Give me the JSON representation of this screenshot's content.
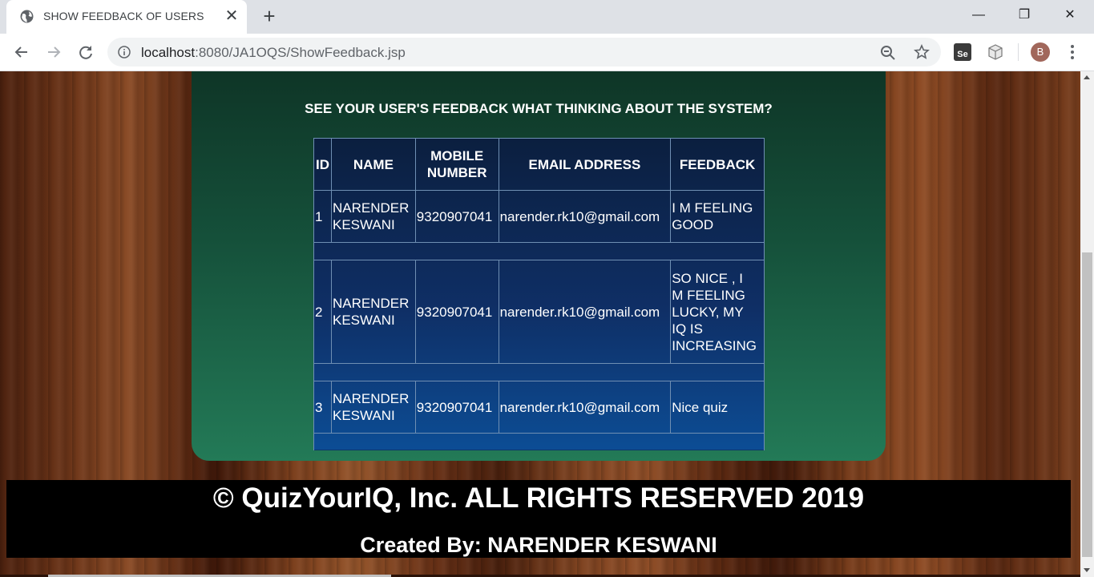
{
  "browser": {
    "tab_title": "SHOW FEEDBACK OF USERS",
    "tab_close": "✕",
    "new_tab": "+",
    "url_host": "localhost",
    "url_path": ":8080/JA1OQS/ShowFeedback.jsp",
    "avatar_letter": "B",
    "ext_label": "Se",
    "window_min": "—",
    "window_max": "❐",
    "window_close": "✕"
  },
  "page": {
    "heading": "SEE YOUR USER'S FEEDBACK WHAT THINKING ABOUT THE SYSTEM?",
    "table": {
      "headers": {
        "id": "ID",
        "name": "NAME",
        "mobile_line1": "MOBILE",
        "mobile_line2": "NUMBER",
        "email": "EMAIL ADDRESS",
        "feedback": "FEEDBACK"
      },
      "rows": [
        {
          "id": "1",
          "name_line1": "NARENDER",
          "name_line2": "KESWANI",
          "mobile": "9320907041",
          "email": "narender.rk10@gmail.com",
          "feedback_lines": [
            "I M FEELING",
            "GOOD"
          ]
        },
        {
          "id": "2",
          "name_line1": "NARENDER",
          "name_line2": "KESWANI",
          "mobile": "9320907041",
          "email": "narender.rk10@gmail.com",
          "feedback_lines": [
            "SO NICE , I",
            "M FEELING",
            "LUCKY, MY",
            "IQ IS",
            "INCREASING"
          ]
        },
        {
          "id": "3",
          "name_line1": "NARENDER",
          "name_line2": "KESWANI",
          "mobile": "9320907041",
          "email": "narender.rk10@gmail.com",
          "feedback_lines": [
            "Nice quiz"
          ]
        }
      ]
    },
    "footer": {
      "copyright": "© QuizYourIQ, Inc. ALL RIGHTS RESERVED 2019",
      "created_by": "Created By: NARENDER KESWANI"
    }
  },
  "colors": {
    "panel_top": "#0e3325",
    "panel_bottom": "#237a57",
    "table_top": "#0b1f3f",
    "table_bottom": "#0c4d95",
    "footer_bg": "#000000"
  },
  "icons": [
    "globe-icon",
    "back-arrow-icon",
    "forward-arrow-icon",
    "reload-icon",
    "info-icon",
    "zoom-icon",
    "star-icon",
    "cube-icon",
    "kebab-menu-icon"
  ]
}
